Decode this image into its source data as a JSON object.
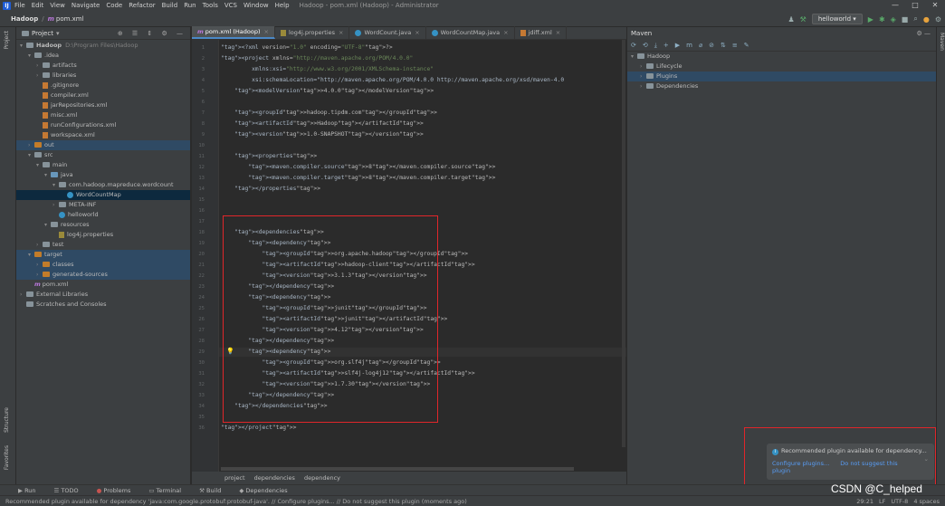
{
  "menubar": {
    "items": [
      "File",
      "Edit",
      "View",
      "Navigate",
      "Code",
      "Refactor",
      "Build",
      "Run",
      "Tools",
      "VCS",
      "Window",
      "Help"
    ],
    "title": "Hadoop - pom.xml (Hadoop) - Administrator"
  },
  "navbar": {
    "project": "Hadoop",
    "file": "pom.xml",
    "run_config": "helloworld"
  },
  "project_panel": {
    "title": "Project",
    "tree": [
      {
        "d": 0,
        "a": "▾",
        "i": "folder",
        "t": "Hadoop",
        "s": "D:\\Program Files\\Hadoop",
        "bold": true
      },
      {
        "d": 1,
        "a": "▾",
        "i": "folder",
        "t": ".idea"
      },
      {
        "d": 2,
        "a": "›",
        "i": "folder",
        "t": "artifacts"
      },
      {
        "d": 2,
        "a": "›",
        "i": "folder",
        "t": "libraries"
      },
      {
        "d": 2,
        "a": "",
        "i": "file",
        "t": ".gitignore"
      },
      {
        "d": 2,
        "a": "",
        "i": "file",
        "t": "compiler.xml"
      },
      {
        "d": 2,
        "a": "",
        "i": "file",
        "t": "jarRepositories.xml"
      },
      {
        "d": 2,
        "a": "",
        "i": "file",
        "t": "misc.xml"
      },
      {
        "d": 2,
        "a": "",
        "i": "file",
        "t": "runConfigurations.xml"
      },
      {
        "d": 2,
        "a": "",
        "i": "file",
        "t": "workspace.xml"
      },
      {
        "d": 1,
        "a": "›",
        "i": "orange",
        "t": "out",
        "hi": true
      },
      {
        "d": 1,
        "a": "▾",
        "i": "folder",
        "t": "src"
      },
      {
        "d": 2,
        "a": "▾",
        "i": "folder",
        "t": "main"
      },
      {
        "d": 3,
        "a": "▾",
        "i": "blue",
        "t": "java"
      },
      {
        "d": 4,
        "a": "▾",
        "i": "folder",
        "t": "com.hadoop.mapreduce.wordcount"
      },
      {
        "d": 5,
        "a": "",
        "i": "cls",
        "t": "WordCountMap",
        "sel": true
      },
      {
        "d": 4,
        "a": "›",
        "i": "folder",
        "t": "META-INF"
      },
      {
        "d": 4,
        "a": "",
        "i": "cls",
        "t": "helloworld"
      },
      {
        "d": 3,
        "a": "▾",
        "i": "folder",
        "t": "resources"
      },
      {
        "d": 4,
        "a": "",
        "i": "prop",
        "t": "log4j.properties"
      },
      {
        "d": 2,
        "a": "›",
        "i": "folder",
        "t": "test"
      },
      {
        "d": 1,
        "a": "▾",
        "i": "orange",
        "t": "target",
        "hi": true
      },
      {
        "d": 2,
        "a": "›",
        "i": "orange",
        "t": "classes",
        "hi": true
      },
      {
        "d": 2,
        "a": "›",
        "i": "orange",
        "t": "generated-sources",
        "hi": true
      },
      {
        "d": 1,
        "a": "",
        "i": "m",
        "t": "pom.xml"
      },
      {
        "d": 0,
        "a": "›",
        "i": "folder",
        "t": "External Libraries"
      },
      {
        "d": 0,
        "a": "",
        "i": "folder",
        "t": "Scratches and Consoles"
      }
    ]
  },
  "tabs": [
    {
      "label": "pom.xml (Hadoop)",
      "active": true
    },
    {
      "label": "log4j.properties"
    },
    {
      "label": "WordCount.java"
    },
    {
      "label": "WordCountMap.java"
    },
    {
      "label": "jdiff.xml"
    }
  ],
  "code": [
    "<?xml version=\"1.0\" encoding=\"UTF-8\"?>",
    "<project xmlns=\"http://maven.apache.org/POM/4.0.0\"",
    "         xmlns:xsi=\"http://www.w3.org/2001/XMLSchema-instance\"",
    "         xsi:schemaLocation=\"http://maven.apache.org/POM/4.0.0 http://maven.apache.org/xsd/maven-4.0",
    "    <modelVersion>4.0.0</modelVersion>",
    "",
    "    <groupId>hadoop.tipdm.com</groupId>",
    "    <artifactId>Hadoop</artifactId>",
    "    <version>1.0-SNAPSHOT</version>",
    "",
    "    <properties>",
    "        <maven.compiler.source>8</maven.compiler.source>",
    "        <maven.compiler.target>8</maven.compiler.target>",
    "    </properties>",
    "",
    "",
    "",
    "    <dependencies>",
    "        <dependency>",
    "            <groupId>org.apache.hadoop</groupId>",
    "            <artifactId>hadoop-client</artifactId>",
    "            <version>3.1.3</version>",
    "        </dependency>",
    "        <dependency>",
    "            <groupId>junit</groupId>",
    "            <artifactId>junit</artifactId>",
    "            <version>4.12</version>",
    "        </dependency>",
    "        <dependency>",
    "            <groupId>org.slf4j</groupId>",
    "            <artifactId>slf4j-log4j12</artifactId>",
    "            <version>1.7.30</version>",
    "        </dependency>",
    "    </dependencies>",
    "",
    "</project>"
  ],
  "editor_breadcrumb": [
    "project",
    "dependencies",
    "dependency"
  ],
  "maven": {
    "title": "Maven",
    "items": [
      {
        "d": 0,
        "a": "▾",
        "t": "Hadoop"
      },
      {
        "d": 1,
        "a": "›",
        "t": "Lifecycle"
      },
      {
        "d": 1,
        "a": "›",
        "t": "Plugins",
        "sel": true
      },
      {
        "d": 1,
        "a": "›",
        "t": "Dependencies"
      }
    ]
  },
  "notification": {
    "title": "Recommended plugin available for dependency...",
    "configure": "Configure plugins...",
    "dismiss": "Do not suggest this plugin"
  },
  "toolwindows": [
    "Run",
    "TODO",
    "Problems",
    "Terminal",
    "Build",
    "Dependencies"
  ],
  "status": {
    "message": "Recommended plugin available for dependency 'java:com.google.protobuf:protobuf-java'. // Configure plugins... // Do not suggest this plugin (moments ago)",
    "position": "29:21",
    "line_sep": "LF",
    "encoding": "UTF-8",
    "indent": "4 spaces"
  },
  "watermark": "CSDN @C_helped",
  "side_tabs": {
    "left_top": "Project",
    "left_structure": "Structure",
    "left_favorites": "Favorites",
    "right": "Maven"
  }
}
